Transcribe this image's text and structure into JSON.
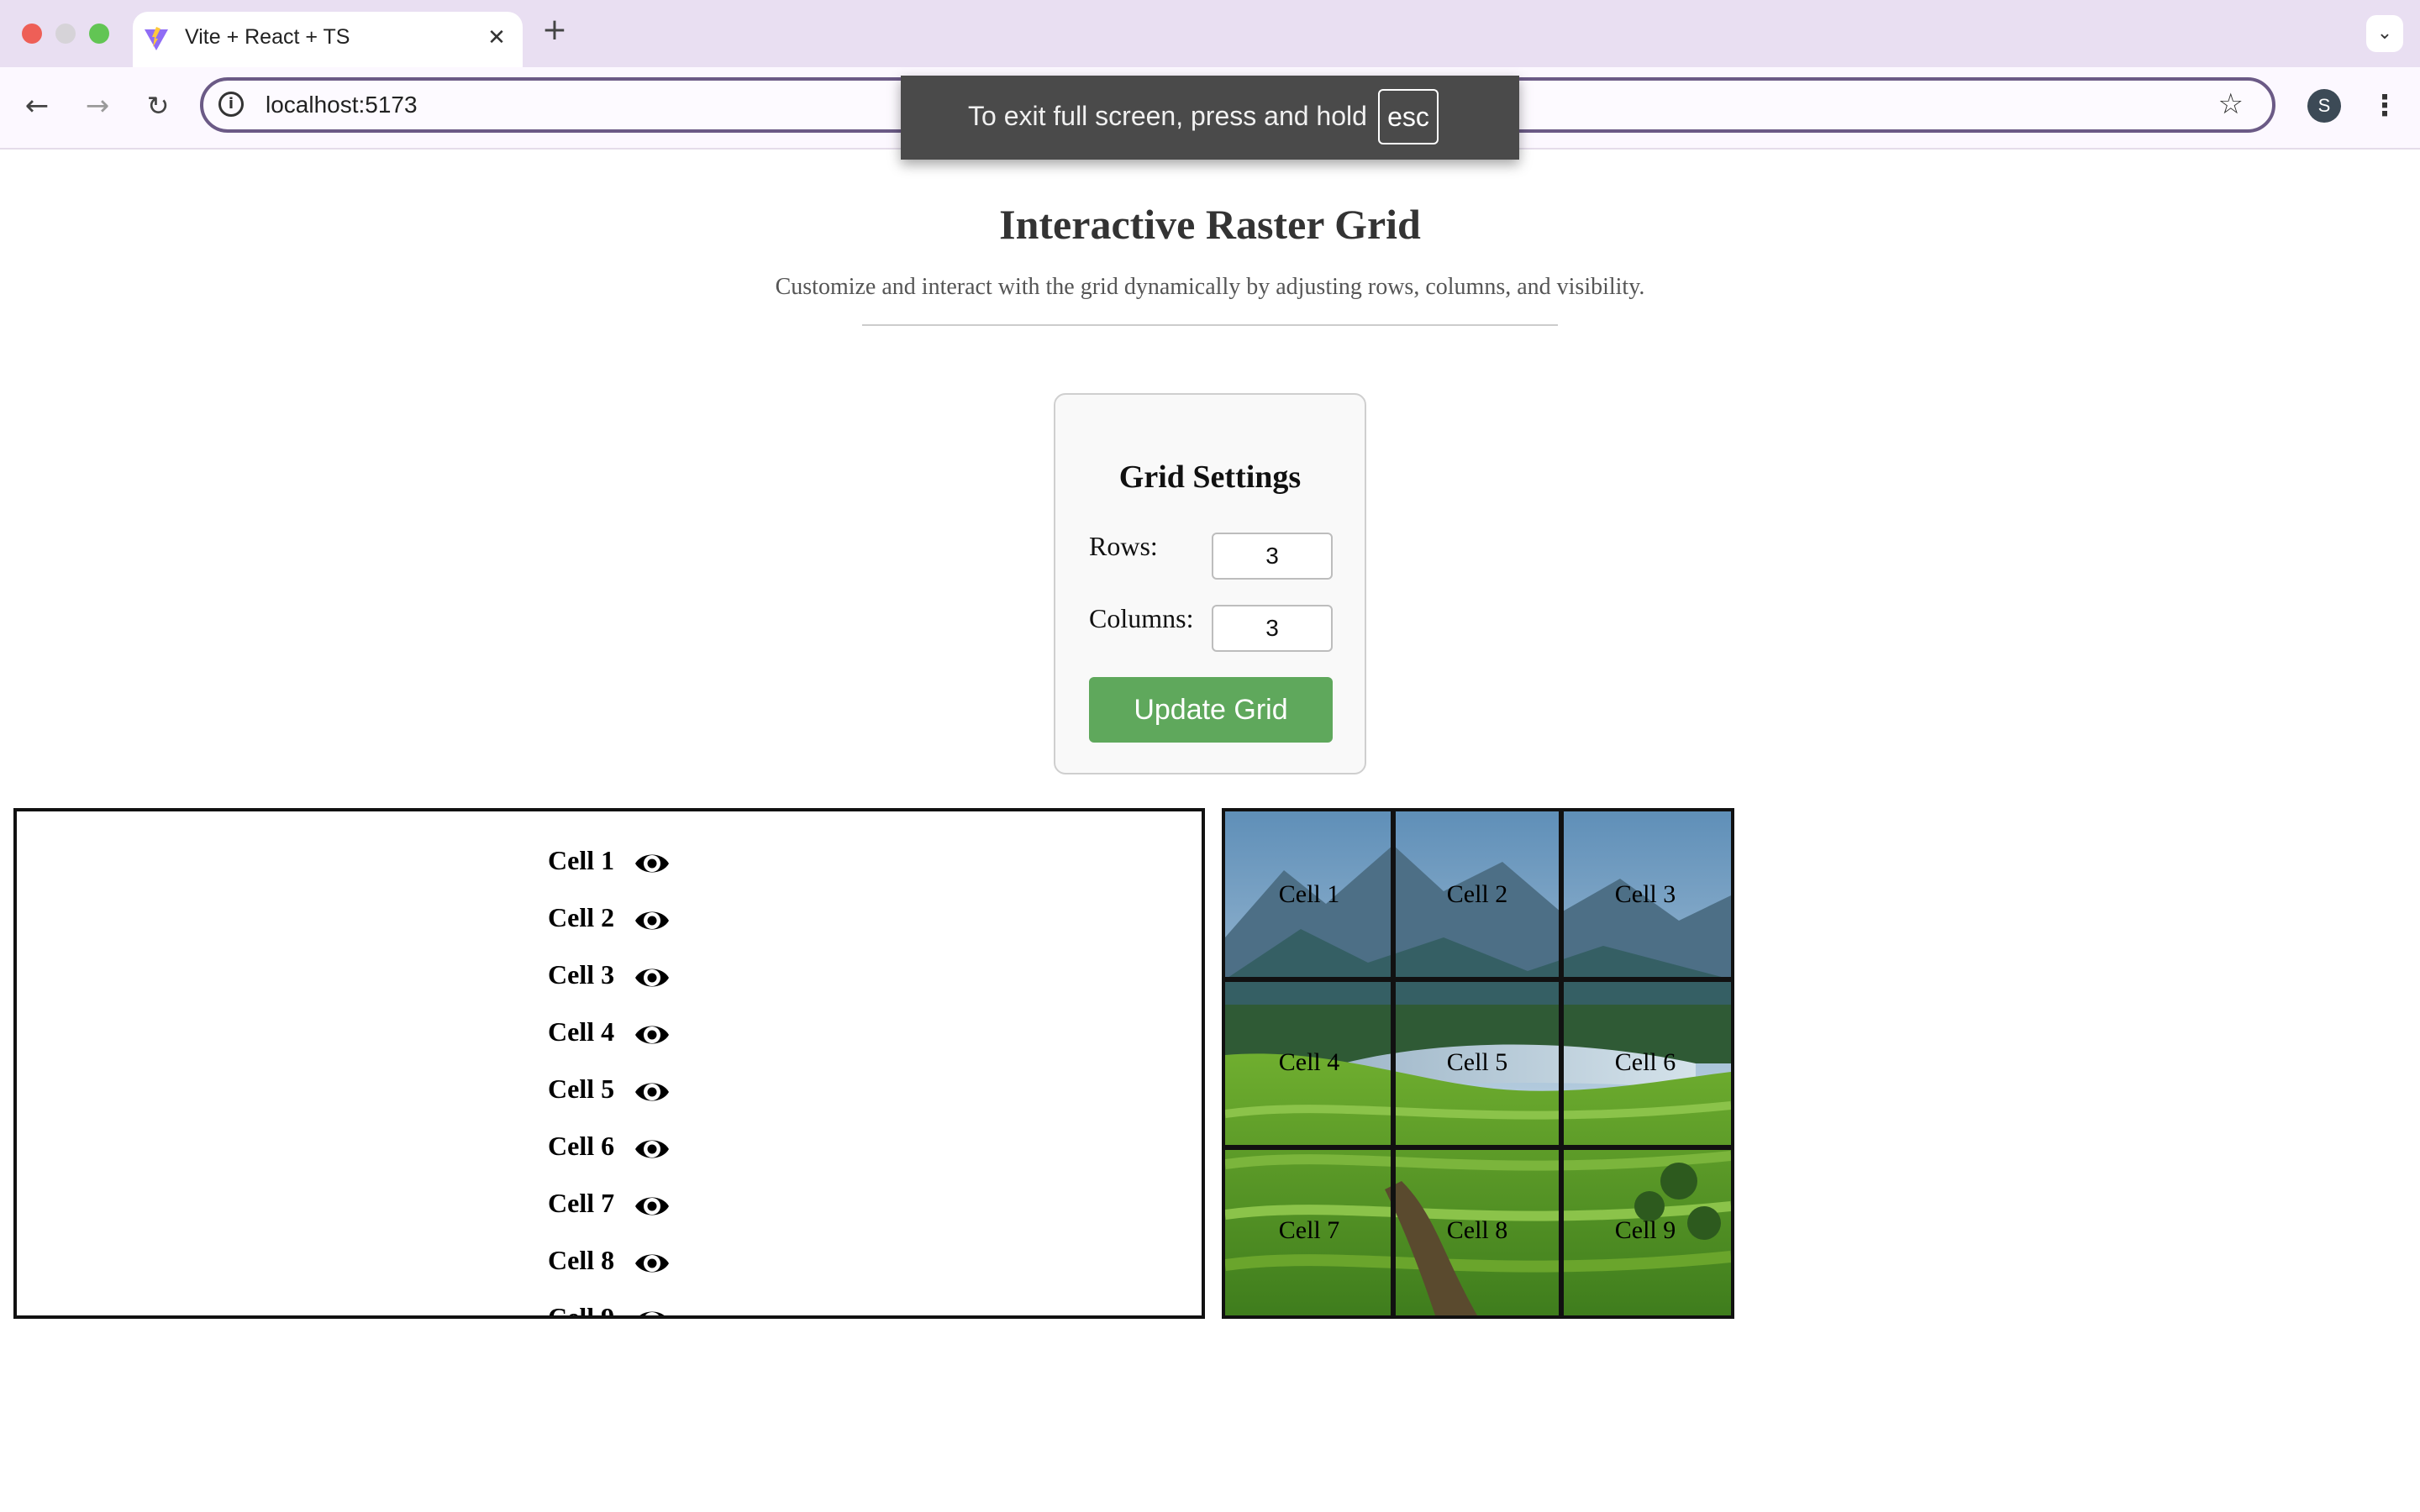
{
  "browser": {
    "tab_title": "Vite + React + TS",
    "tab_close_icon": "close-icon",
    "new_tab_icon": "plus-icon",
    "url": "localhost:5173",
    "profile_initial": "S"
  },
  "fullscreen_notice": {
    "text": "To exit full screen, press and hold",
    "key": "esc"
  },
  "page": {
    "title": "Interactive Raster Grid",
    "subtitle": "Customize and interact with the grid dynamically by adjusting rows, columns, and visibility."
  },
  "settings": {
    "title": "Grid Settings",
    "rows_label": "Rows:",
    "rows_value": "3",
    "columns_label": "Columns:",
    "columns_value": "3",
    "update_button": "Update Grid"
  },
  "cells": [
    {
      "label": "Cell 1",
      "visible": true
    },
    {
      "label": "Cell 2",
      "visible": true
    },
    {
      "label": "Cell 3",
      "visible": true
    },
    {
      "label": "Cell 4",
      "visible": true
    },
    {
      "label": "Cell 5",
      "visible": true
    },
    {
      "label": "Cell 6",
      "visible": true
    },
    {
      "label": "Cell 7",
      "visible": true
    },
    {
      "label": "Cell 8",
      "visible": true
    },
    {
      "label": "Cell 9",
      "visible": true
    }
  ],
  "grid": {
    "rows": 3,
    "columns": 3,
    "image_subject": "mountain landscape with lake and green tea plantation"
  },
  "colors": {
    "update_button": "#5fa85c",
    "tab_strip": "#e9dff2",
    "toast": "#4a4a4a"
  }
}
